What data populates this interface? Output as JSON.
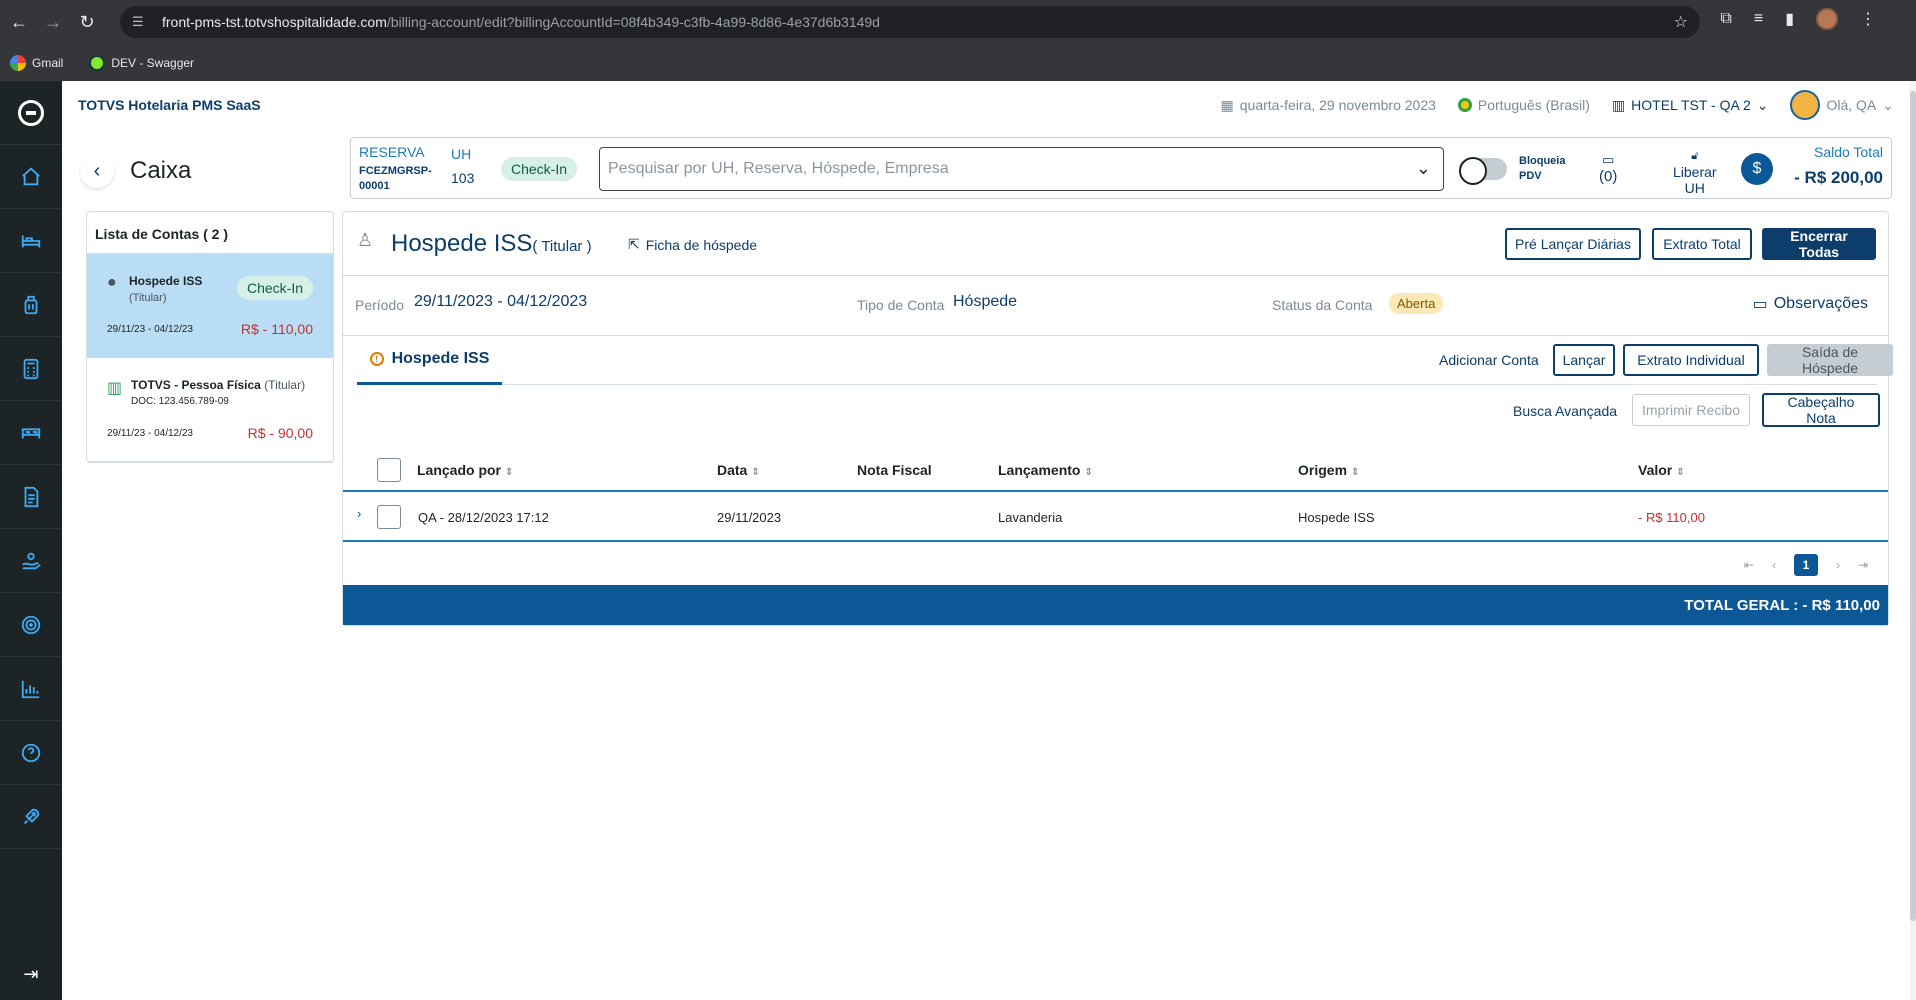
{
  "browser": {
    "url_host": "front-pms-tst.totvshospitalidade.com",
    "url_path": "/billing-account/edit?billingAccountId=08f4b349-c3fb-4a99-8d86-4e37d6b3149d",
    "bookmarks": [
      "Gmail",
      "DEV - Swagger"
    ]
  },
  "app": {
    "title": "TOTVS Hotelaria PMS SaaS",
    "date": "quarta-feira, 29 novembro 2023",
    "language": "Português (Brasil)",
    "hotel": "HOTEL TST - QA 2",
    "user": "Olá, QA"
  },
  "sidebar": {
    "icons": [
      "home-icon",
      "bed-icon",
      "luggage-icon",
      "calculator-icon",
      "room-icon",
      "document-icon",
      "hand-money-icon",
      "target-icon",
      "chart-icon",
      "help-icon",
      "rocket-icon"
    ]
  },
  "page": {
    "title": "Caixa"
  },
  "reservation": {
    "label": "RESERVA",
    "code_line1": "FCEZMGRSP-",
    "code_line2": "00001",
    "uh_label": "UH",
    "uh_number": "103",
    "status": "Check-In",
    "search_placeholder": "Pesquisar por UH, Reserva, Hóspede, Empresa",
    "bloqueia_line1": "Bloqueia",
    "bloqueia_line2": "PDV",
    "messages_count": "(0)",
    "liberar_line1": "Liberar",
    "liberar_line2": "UH",
    "saldo_label": "Saldo Total",
    "saldo_value": "- R$ 200,00"
  },
  "accounts": {
    "header": "Lista de Contas ( 2 )",
    "items": [
      {
        "name": "Hospede ISS",
        "role": "(Titular)",
        "status": "Check-In",
        "dates": "29/11/23 - 04/12/23",
        "value": "R$ - 110,00"
      },
      {
        "name": "TOTVS - Pessoa Física",
        "role": "(Titular)",
        "doc": "DOC: 123.456.789-09",
        "dates": "29/11/23 - 04/12/23",
        "value": "R$ - 90,00"
      }
    ]
  },
  "guest": {
    "name": "Hospede ISS",
    "role": "( Titular )",
    "ficha": "Ficha de hóspede",
    "btn_pre": "Pré Lançar Diárias",
    "btn_extrato": "Extrato Total",
    "btn_encerrar": "Encerrar Todas"
  },
  "details": {
    "periodo_label": "Período",
    "periodo_value": "29/11/2023 - 04/12/2023",
    "tipo_label": "Tipo de Conta",
    "tipo_value": "Hóspede",
    "status_label": "Status da Conta",
    "status_value": "Aberta",
    "observacoes": "Observações"
  },
  "tabs": {
    "active": "Hospede ISS",
    "adicionar": "Adicionar Conta",
    "btn_lancar": "Lançar",
    "btn_extrato_ind": "Extrato Individual",
    "btn_saida": "Saída de Hóspede",
    "busca": "Busca Avançada",
    "btn_imprimir": "Imprimir Recibo",
    "btn_cabecalho": "Cabeçalho Nota"
  },
  "table": {
    "columns": [
      "Lançado por",
      "Data",
      "Nota Fiscal",
      "Lançamento",
      "Origem",
      "Valor"
    ],
    "rows": [
      {
        "lancado_por": "QA - 28/12/2023 17:12",
        "data": "29/11/2023",
        "nota_fiscal": "",
        "lancamento": "Lavanderia",
        "origem": "Hospede ISS",
        "valor": "- R$ 110,00"
      }
    ]
  },
  "pagination": {
    "current": "1"
  },
  "footer": {
    "total": "TOTAL GERAL : - R$ 110,00"
  }
}
